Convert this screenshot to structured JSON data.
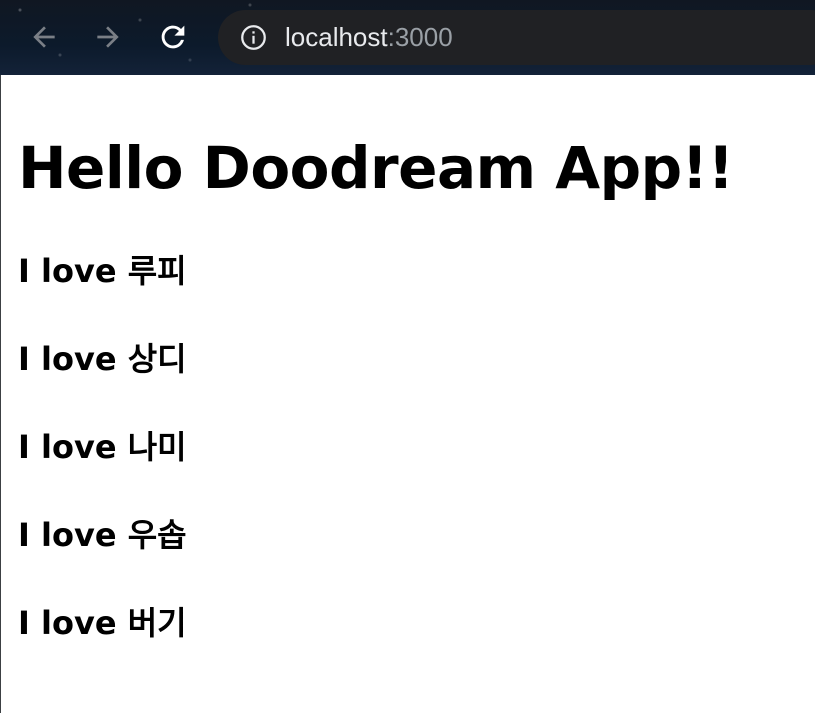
{
  "browser": {
    "url_host": "localhost",
    "url_port": ":3000",
    "icons": {
      "back": "arrow-left-icon",
      "forward": "arrow-right-icon",
      "reload": "reload-icon",
      "site_info": "info-circle-icon"
    },
    "colors": {
      "omnibox_bg": "#202124",
      "url_host": "#e8eaed",
      "url_port": "#9aa0a6",
      "nav_disabled": "#7a7f86",
      "nav_enabled": "#ffffff"
    }
  },
  "page": {
    "title": "Hello Doodream App!!",
    "items": [
      {
        "label": "I love 루피"
      },
      {
        "label": "I love 상디"
      },
      {
        "label": "I love 나미"
      },
      {
        "label": "I love 우솝"
      },
      {
        "label": "I love 버기"
      }
    ]
  }
}
